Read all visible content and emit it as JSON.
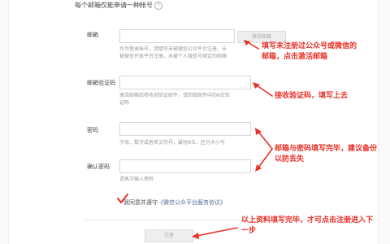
{
  "form": {
    "notice": "每个邮箱仅能申请一种帐号",
    "email": {
      "label": "邮箱",
      "hint_line1": "作为登录帐号，请填写未被微信公众平台注册，未",
      "hint_line2": "被微信开放平台注册，未被个人微信号绑定的邮箱",
      "activate_label": "激活邮箱"
    },
    "code": {
      "label": "邮箱验证码",
      "hint_line1": "激活邮箱后将收到验证邮件，请回填邮件中的6位验",
      "hint_line2": "证码"
    },
    "password": {
      "label": "密码",
      "hint": "字母、数字或者英文符号，最短8位，区分大小写"
    },
    "confirm": {
      "label": "确认密码",
      "hint": "请再次输入密码"
    },
    "agreement": {
      "prefix": "我同意并遵守",
      "link": "《微信公众平台服务协议》"
    },
    "register_label": "注册"
  },
  "annotations": {
    "a1_line1": "填写未注册过公众号或微信的",
    "a1_line2": "邮箱，点击激活邮箱",
    "a2": "接收验证码，填写上去",
    "a3_line1": "邮箱与密码填写完毕，建议备份",
    "a3_line2": "以防丢失",
    "a4_line1": "以上资料填写完毕，才可点击注册进入下",
    "a4_line2": "一步"
  },
  "colors": {
    "annotation": "#e8322a",
    "link": "#576b95",
    "button_bg": "#eeeeee"
  }
}
